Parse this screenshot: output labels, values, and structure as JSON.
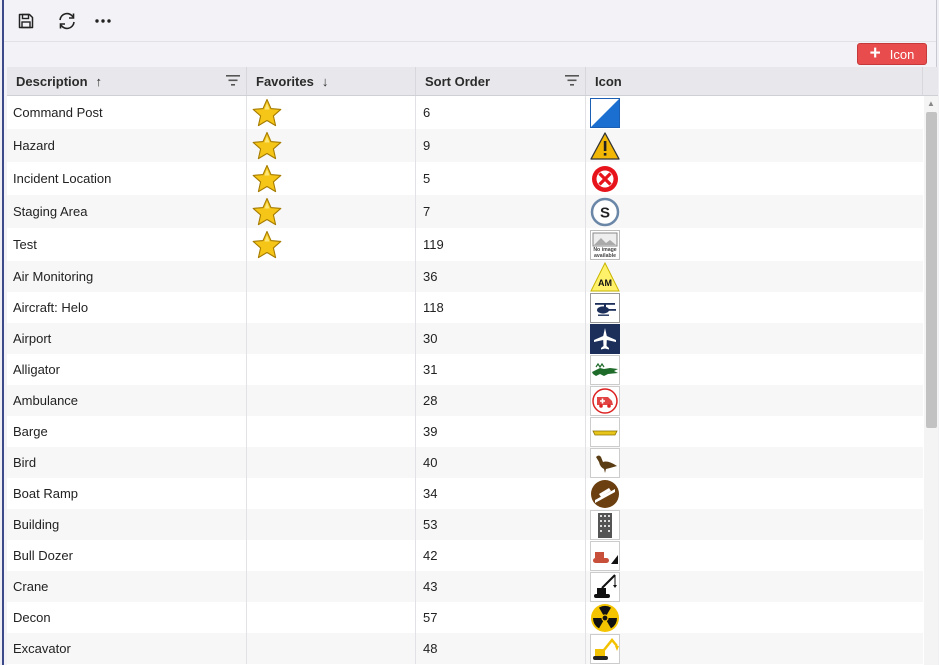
{
  "toolbar": {
    "icons": [
      "save-icon",
      "refresh-icon",
      "more-icon"
    ],
    "add_label": "Icon"
  },
  "columns": [
    {
      "label": "Description",
      "sort": "asc",
      "filter": true
    },
    {
      "label": "Favorites",
      "sort": "desc",
      "filter": false
    },
    {
      "label": "Sort Order",
      "sort": "",
      "filter": true
    },
    {
      "label": "Icon",
      "sort": "",
      "filter": false
    }
  ],
  "sort_arrows": {
    "asc": "↑",
    "desc": "↓"
  },
  "rows": [
    {
      "description": "Command Post",
      "favorite": true,
      "sort_order": "6",
      "icon": "command-post-icon"
    },
    {
      "description": "Hazard",
      "favorite": true,
      "sort_order": "9",
      "icon": "hazard-icon"
    },
    {
      "description": "Incident Location",
      "favorite": true,
      "sort_order": "5",
      "icon": "incident-location-icon"
    },
    {
      "description": "Staging Area",
      "favorite": true,
      "sort_order": "7",
      "icon": "staging-area-icon"
    },
    {
      "description": "Test",
      "favorite": true,
      "sort_order": "119",
      "icon": "no-image-icon"
    },
    {
      "description": "Air Monitoring",
      "favorite": false,
      "sort_order": "36",
      "icon": "air-monitoring-icon"
    },
    {
      "description": "Aircraft: Helo",
      "favorite": false,
      "sort_order": "118",
      "icon": "helicopter-icon"
    },
    {
      "description": "Airport",
      "favorite": false,
      "sort_order": "30",
      "icon": "airport-icon"
    },
    {
      "description": "Alligator",
      "favorite": false,
      "sort_order": "31",
      "icon": "alligator-icon"
    },
    {
      "description": "Ambulance",
      "favorite": false,
      "sort_order": "28",
      "icon": "ambulance-icon"
    },
    {
      "description": "Barge",
      "favorite": false,
      "sort_order": "39",
      "icon": "barge-icon"
    },
    {
      "description": "Bird",
      "favorite": false,
      "sort_order": "40",
      "icon": "bird-icon"
    },
    {
      "description": "Boat Ramp",
      "favorite": false,
      "sort_order": "34",
      "icon": "boat-ramp-icon"
    },
    {
      "description": "Building",
      "favorite": false,
      "sort_order": "53",
      "icon": "building-icon"
    },
    {
      "description": "Bull Dozer",
      "favorite": false,
      "sort_order": "42",
      "icon": "bulldozer-icon"
    },
    {
      "description": "Crane",
      "favorite": false,
      "sort_order": "43",
      "icon": "crane-icon"
    },
    {
      "description": "Decon",
      "favorite": false,
      "sort_order": "57",
      "icon": "decon-icon"
    },
    {
      "description": "Excavator",
      "favorite": false,
      "sort_order": "48",
      "icon": "excavator-icon"
    }
  ],
  "no_image_text": [
    "No image",
    "available"
  ],
  "air_monitoring_text": "AM",
  "staging_text": "S",
  "colors": {
    "accent_button": "#e84c4c",
    "header_bg": "#e8e8ec",
    "star": "#f5c518",
    "airport_bg": "#1b2f5a",
    "alligator": "#1f6b2a",
    "hazard": "#f2b705"
  }
}
